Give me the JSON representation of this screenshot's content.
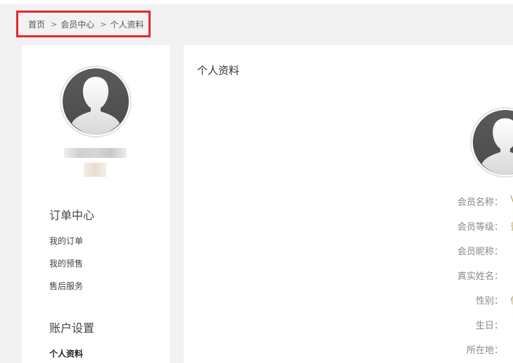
{
  "breadcrumb": {
    "items": [
      {
        "label": "首页"
      },
      {
        "label": "会员中心"
      },
      {
        "label": "个人资料"
      }
    ],
    "separator": ">"
  },
  "sidebar": {
    "sections": [
      {
        "title": "订单中心",
        "items": [
          {
            "label": "我的订单"
          },
          {
            "label": "我的预售"
          },
          {
            "label": "售后服务"
          }
        ]
      },
      {
        "title": "账户设置",
        "items": [
          {
            "label": "个人资料",
            "active": true
          }
        ]
      }
    ]
  },
  "main": {
    "title": "个人资料",
    "form": {
      "fields": [
        {
          "label": "会员名称：",
          "value": "V"
        },
        {
          "label": "会员等级：",
          "value": "普"
        },
        {
          "label": "会员昵称：",
          "value": ""
        },
        {
          "label": "真实姓名：",
          "value": ""
        },
        {
          "label": "性别：",
          "value": "保"
        },
        {
          "label": "生日：",
          "value": ""
        },
        {
          "label": "所在地：",
          "value": ""
        }
      ]
    }
  },
  "colors": {
    "highlight_border": "#e8262d",
    "page_background": "#f2f2f2",
    "value_text": "#c8a24a"
  },
  "icons": {
    "avatar": "default-user-silhouette-icon",
    "breadcrumb_separator": "chevron-right-icon"
  }
}
